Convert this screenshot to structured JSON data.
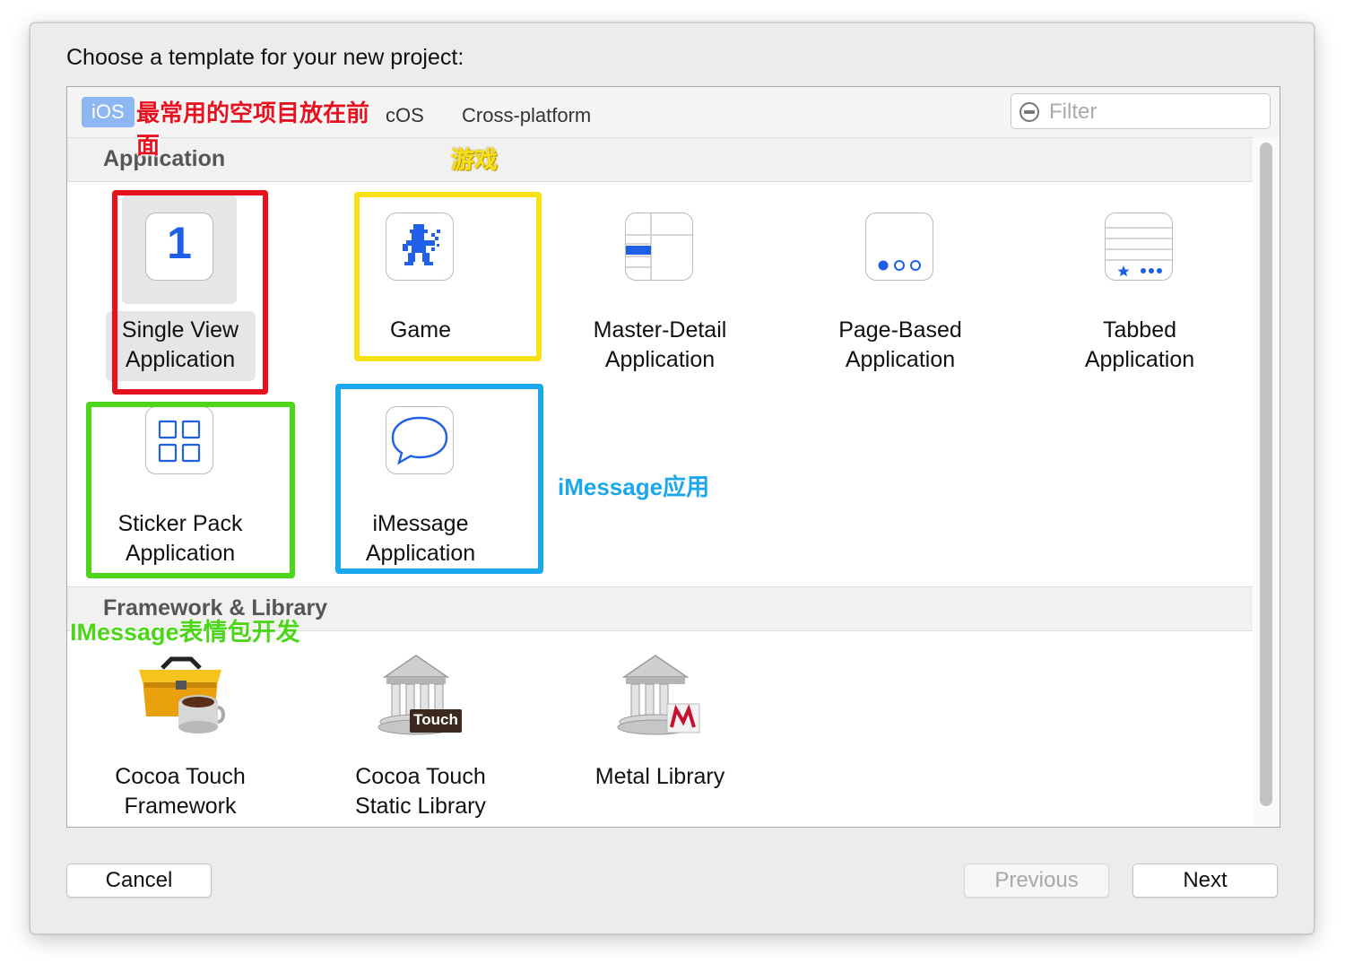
{
  "dialog": {
    "prompt": "Choose a template for your new project:",
    "platform_tabs": [
      {
        "label": "iOS",
        "selected": true
      },
      {
        "label": "cOS",
        "selected": false
      },
      {
        "label": "Cross-platform",
        "selected": false
      }
    ],
    "filter_placeholder": "Filter",
    "sections": [
      {
        "title": "Application",
        "templates": [
          {
            "label": "Single View\nApplication",
            "icon": "single-view-icon",
            "selected": true
          },
          {
            "label": "Game",
            "icon": "game-sprite-icon"
          },
          {
            "label": "Master-Detail\nApplication",
            "icon": "master-detail-icon"
          },
          {
            "label": "Page-Based\nApplication",
            "icon": "page-dots-icon"
          },
          {
            "label": "Tabbed\nApplication",
            "icon": "tab-bar-icon"
          },
          {
            "label": "Sticker Pack\nApplication",
            "icon": "sticker-grid-icon"
          },
          {
            "label": "iMessage\nApplication",
            "icon": "speech-bubble-icon"
          }
        ]
      },
      {
        "title": "Framework & Library",
        "templates": [
          {
            "label": "Cocoa Touch\nFramework",
            "icon": "toolbox-icon"
          },
          {
            "label": "Cocoa Touch\nStatic Library",
            "icon": "library-building-icon",
            "badge": "Touch"
          },
          {
            "label": "Metal Library",
            "icon": "metal-library-icon"
          }
        ]
      }
    ],
    "buttons": {
      "cancel": "Cancel",
      "previous": "Previous",
      "next": "Next"
    },
    "single_view_icon_glyph": "1"
  },
  "annotations": [
    {
      "text": "最常用的空项目放在前面",
      "color": "#e8111f"
    },
    {
      "text": "游戏",
      "color": "#f7e014"
    },
    {
      "text": "iMessage应用",
      "color": "#1aa7ec"
    },
    {
      "text": "IMessage表情包开发",
      "color": "#4cd61a"
    }
  ]
}
